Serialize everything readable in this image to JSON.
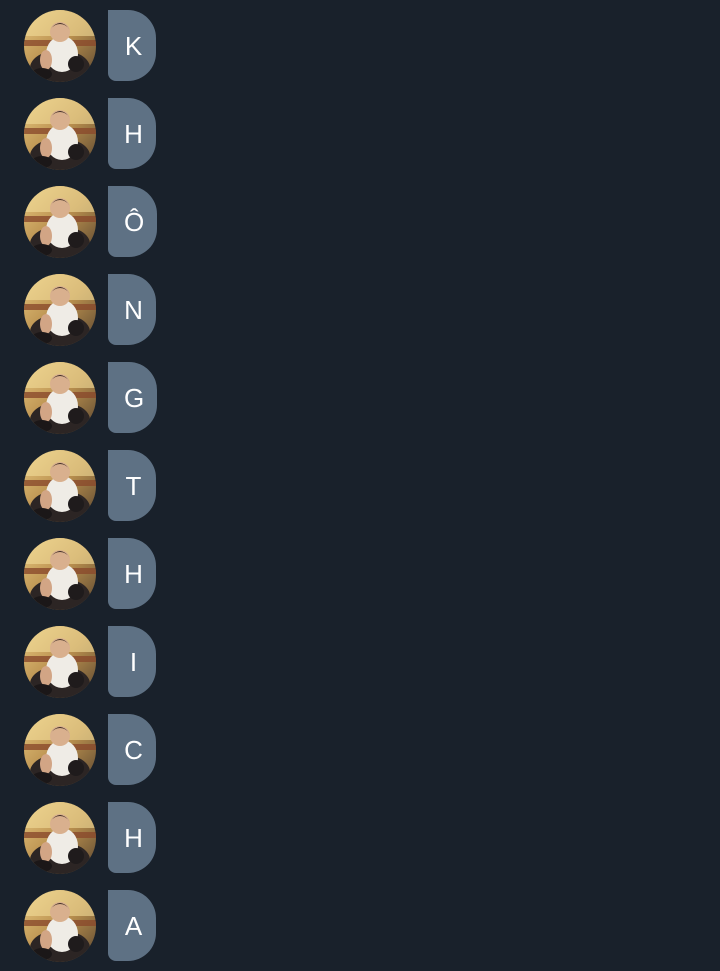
{
  "colors": {
    "background": "#19212b",
    "bubble": "#5e7184",
    "text": "#ffffff"
  },
  "avatar_icon": "user-photo-avatar",
  "messages": [
    {
      "text": "K"
    },
    {
      "text": "H"
    },
    {
      "text": "Ô"
    },
    {
      "text": "N"
    },
    {
      "text": "G"
    },
    {
      "text": "T"
    },
    {
      "text": "H"
    },
    {
      "text": "I"
    },
    {
      "text": "C"
    },
    {
      "text": "H"
    },
    {
      "text": "A"
    }
  ]
}
